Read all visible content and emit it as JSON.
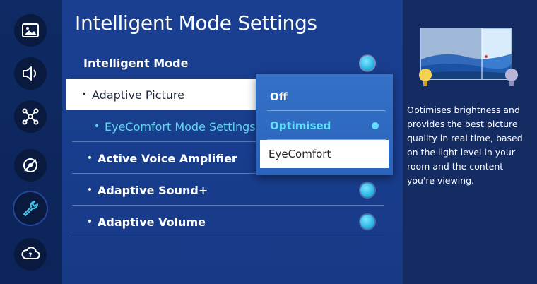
{
  "sidebar": {
    "icons": [
      "picture-icon",
      "sound-icon",
      "network-icon",
      "broadcast-icon",
      "wrench-icon",
      "support-icon"
    ]
  },
  "main": {
    "title": "Intelligent Mode Settings",
    "items": [
      {
        "label": "Intelligent Mode",
        "bullet": ""
      },
      {
        "label": "Adaptive Picture",
        "bullet": "•"
      },
      {
        "label": "EyeComfort Mode Settings",
        "bullet": "•"
      },
      {
        "label": "Active Voice Amplifier",
        "bullet": "•"
      },
      {
        "label": "Adaptive Sound+",
        "bullet": "•"
      },
      {
        "label": "Adaptive Volume",
        "bullet": "•"
      }
    ]
  },
  "dropdown": {
    "options": [
      "Off",
      "Optimised",
      "EyeComfort"
    ],
    "selected": "Optimised",
    "focused": "EyeComfort"
  },
  "info": {
    "description": "Optimises brightness and provides the best picture quality in real time, based on the light level in your room and the content you're viewing."
  },
  "colors": {
    "accent": "#62d4ef",
    "panel": "#1a3f91",
    "rail": "#0f2a64"
  }
}
